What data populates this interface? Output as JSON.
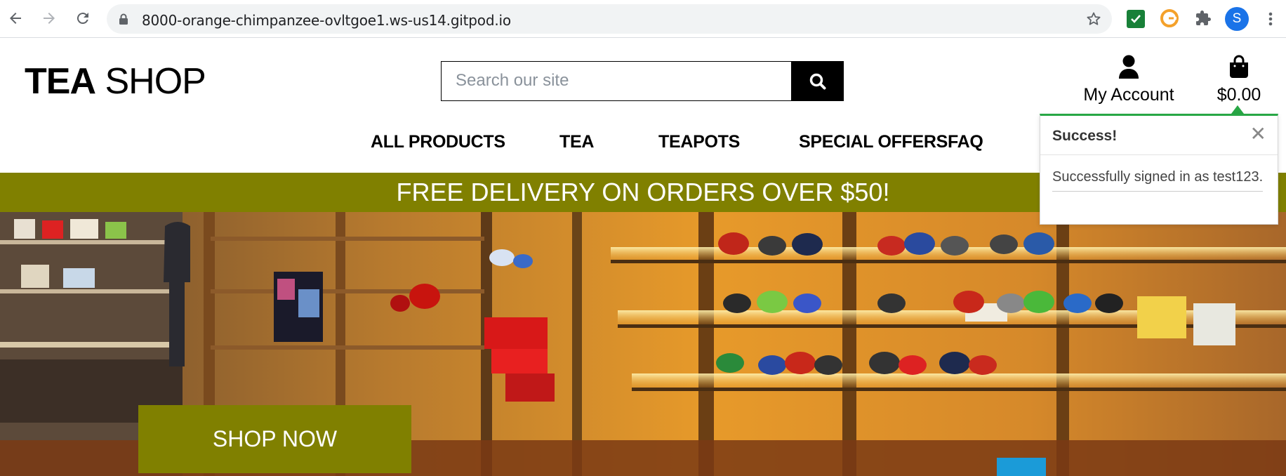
{
  "browser": {
    "url": "8000-orange-chimpanzee-ovltgoe1.ws-us14.gitpod.io",
    "profile_initial": "S"
  },
  "site": {
    "logo_bold": "TEA",
    "logo_light": "SHOP",
    "search_placeholder": "Search our site",
    "account_label": "My Account",
    "bag_total": "$0.00"
  },
  "nav": {
    "items": [
      "ALL PRODUCTS",
      "TEA",
      "TEAPOTS",
      "SPECIAL OFFERS",
      "FAQ"
    ]
  },
  "banner": {
    "text": "FREE DELIVERY ON ORDERS OVER $50!",
    "color": "#808000"
  },
  "hero": {
    "cta_label": "SHOP NOW"
  },
  "toast": {
    "title": "Success!",
    "close_glyph": "✕",
    "message": "Successfully signed in as test123.",
    "accent_color": "#28a745"
  }
}
